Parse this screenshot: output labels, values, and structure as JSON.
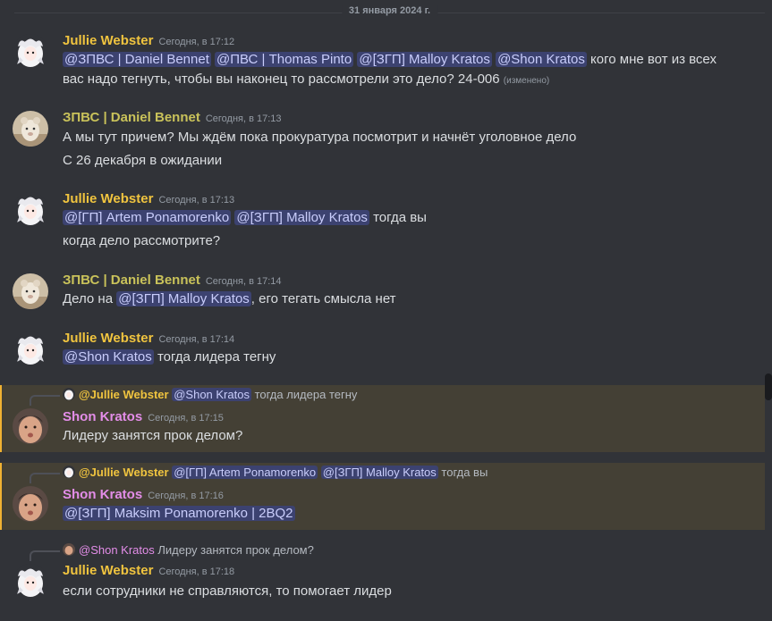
{
  "divider_date": "31 января 2024 г.",
  "colors": {
    "jullie": "#f0c43f",
    "daniel": "#c9c25a",
    "shon": "#e38de8",
    "mention_bg": "#3c4270",
    "highlight_bg": "#444035"
  },
  "messages": [
    {
      "author": "Jullie Webster",
      "timestamp": "Сегодня, в 17:12",
      "line1": {
        "m1": "@ЗПВС | Daniel Bennet",
        "m2": "@ПВС  | Thomas Pinto",
        "m3": "@[ЗГП] Malloy Kratos",
        "m4": "@Shon Kratos",
        "text": " кого мне вот из всех"
      },
      "line2": {
        "text": "вас надо тегнуть, чтобы вы наконец то рассмотрели  это дело? 24-006 ",
        "edited": "(изменено)"
      }
    },
    {
      "author": "ЗПВС | Daniel Bennet",
      "timestamp": "Сегодня, в 17:13",
      "line1": "А мы тут причем? Мы ждём пока прокуратура посмотрит и начнёт уголовное дело",
      "line2": "С 26 декабря в ожидании"
    },
    {
      "author": "Jullie Webster",
      "timestamp": "Сегодня, в 17:13",
      "line1": {
        "m1": "@[ГП] Artem Ponamorenko",
        "m2": "@[ЗГП] Malloy Kratos",
        "text": " тогда вы"
      },
      "line2": "когда дело рассмотрите?"
    },
    {
      "author": "ЗПВС | Daniel Bennet",
      "timestamp": "Сегодня, в 17:14",
      "line1": {
        "pre": "Дело на ",
        "m1": "@[ЗГП] Malloy Kratos",
        "text": ", его тегать смысла нет"
      }
    },
    {
      "author": "Jullie Webster",
      "timestamp": "Сегодня, в 17:14",
      "line1": {
        "m1": "@Shon Kratos",
        "text": " тогда лидера тегну"
      }
    },
    {
      "reply": {
        "author": "@Jullie Webster",
        "m1": "@Shon Kratos",
        "text": " тогда лидера тегну"
      },
      "author": "Shon Kratos",
      "timestamp": "Сегодня, в 17:15",
      "line1": "Лидеру занятся прок делом?"
    },
    {
      "reply": {
        "author": "@Jullie Webster",
        "m1": "@[ГП] Artem Ponamorenko",
        "m2": "@[ЗГП] Malloy Kratos",
        "text": " тогда вы"
      },
      "author": "Shon Kratos",
      "timestamp": "Сегодня, в 17:16",
      "line1": {
        "m1": "@[ЗГП] Maksim Ponamorenko | 2BQ2"
      }
    },
    {
      "reply": {
        "author": "@Shon Kratos",
        "text": " Лидеру занятся прок делом?"
      },
      "author": "Jullie Webster",
      "timestamp": "Сегодня, в 17:18",
      "line1": "если сотрудники не справляются, то помогает лидер"
    }
  ]
}
